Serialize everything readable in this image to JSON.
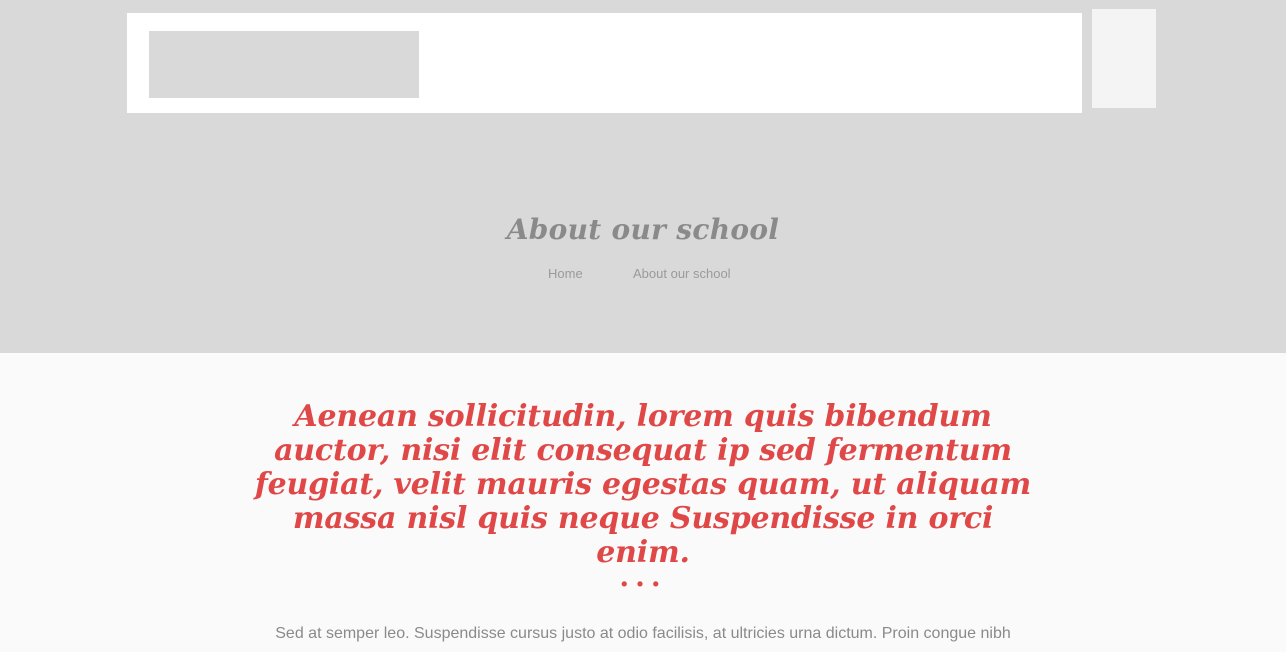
{
  "hero": {
    "title": "About our school",
    "breadcrumb": {
      "home": "Home",
      "current": "About our school"
    }
  },
  "content": {
    "quote": "Aenean sollicitudin, lorem quis bibendum auctor, nisi elit consequat ip sed fermentum feugiat, velit mauris egestas quam, ut aliquam massa nisl quis neque Suspendisse in orci enim.",
    "separator": "...",
    "paragraph": "Sed at semper leo. Suspendisse cursus justo at odio facilisis, at ultricies urna dictum. Proin congue nibh"
  },
  "colors": {
    "accent": "#e04848",
    "hero_bg": "#d9d9d9",
    "muted_text": "#8a8a8a"
  }
}
